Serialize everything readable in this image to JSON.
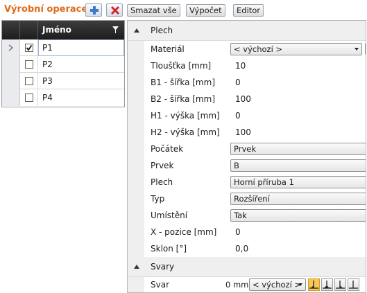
{
  "toolbar": {
    "title": "Výrobní operace",
    "add_icon": "plus-icon",
    "delete_icon": "delete-x-icon",
    "delete_all_label": "Smazat vše",
    "calculate_label": "Výpočet",
    "editor_label": "Editor"
  },
  "grid": {
    "column_name": "Jméno",
    "filter_icon": "filter-icon",
    "rows": [
      {
        "name": "P1",
        "checked": true,
        "current": true
      },
      {
        "name": "P2",
        "checked": false,
        "current": false
      },
      {
        "name": "P3",
        "checked": false,
        "current": false
      },
      {
        "name": "P4",
        "checked": false,
        "current": false
      }
    ]
  },
  "panel": {
    "section_plech": "Plech",
    "section_svary": "Svary",
    "material_label": "Materiál",
    "material_value": "< výchozí >",
    "thickness_label": "Tloušťka [mm]",
    "thickness_value": "10",
    "b1_label": "B1 - šířka [mm]",
    "b1_value": "0",
    "b2_label": "B2 - šířka [mm]",
    "b2_value": "100",
    "h1_label": "H1 - výška [mm]",
    "h1_value": "0",
    "h2_label": "H2 - výška [mm]",
    "h2_value": "100",
    "start_label": "Počátek",
    "start_value": "Prvek",
    "member_label": "Prvek",
    "member_value": "B",
    "plate_label": "Plech",
    "plate_value": "Horní příruba 1",
    "type_label": "Typ",
    "type_value": "Rozšíření",
    "position_label": "Umístění",
    "position_value": "Tak",
    "xpos_label": "X - pozice [mm]",
    "xpos_value": "0",
    "slope_label": "Sklon [°]",
    "slope_value": "0,0",
    "weld_label": "Svar",
    "weld_size": "0 mm",
    "weld_value": "< výchozí >"
  },
  "colors": {
    "title_orange": "#e06a1b",
    "header_dark": "#2a2a2a",
    "section_gray": "#efefef"
  }
}
